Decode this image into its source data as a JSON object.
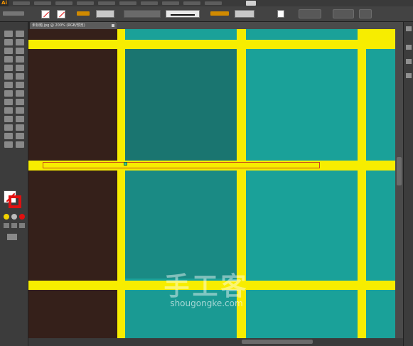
{
  "app": {
    "logo_text": "Ai"
  },
  "document": {
    "tab_title": "未标题.jpg @ 200% (RGB/预览)"
  },
  "watermark": {
    "title": "手工客",
    "url": "shougongke.com"
  },
  "colors": {
    "yellow": "#f7ed00",
    "teal": "#1aa199",
    "dark_teal": "#1a7570",
    "dark_brown": "#35201a",
    "annotation_red": "#e02020"
  },
  "icons": {
    "tools_panel": "tool-icons",
    "annotation": "red-arrow-icon"
  }
}
